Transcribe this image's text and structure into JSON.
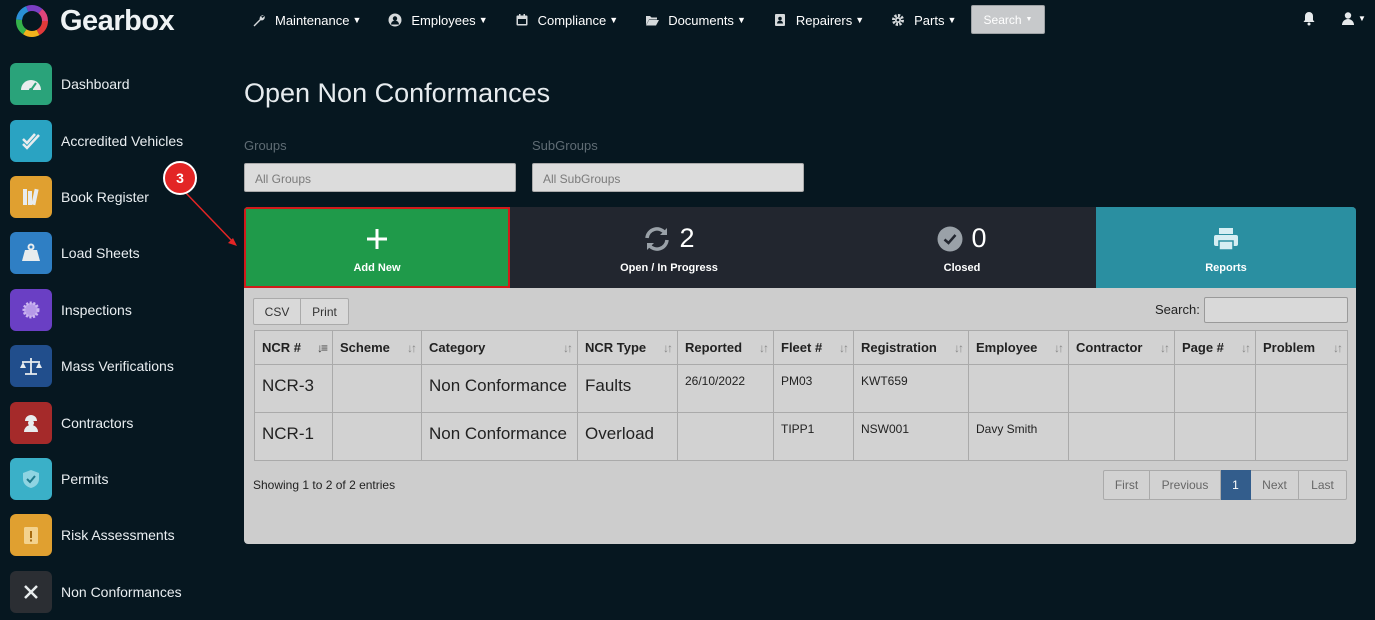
{
  "app": {
    "name": "Gearbox"
  },
  "colors": {
    "accent_green": "#1f9a4a",
    "reports_teal": "#2a8fa1",
    "callout_red": "#e32525",
    "page_active": "#335d8c"
  },
  "nav": {
    "menu": [
      {
        "label": "Maintenance",
        "icon": "wrench-icon"
      },
      {
        "label": "Employees",
        "icon": "person-circle-icon"
      },
      {
        "label": "Compliance",
        "icon": "calendar-icon"
      },
      {
        "label": "Documents",
        "icon": "folder-open-icon"
      },
      {
        "label": "Repairers",
        "icon": "address-book-icon"
      },
      {
        "label": "Parts",
        "icon": "gear-icon"
      }
    ],
    "search_label": "Search"
  },
  "sidebar": {
    "items": [
      {
        "label": "Dashboard",
        "icon": "speedometer-icon",
        "color": "#2aa37a"
      },
      {
        "label": "Accredited Vehicles",
        "icon": "check-double-icon",
        "color": "#2aa3c2"
      },
      {
        "label": "Book Register",
        "icon": "books-icon",
        "color": "#e0a030"
      },
      {
        "label": "Load Sheets",
        "icon": "weight-icon",
        "color": "#2f7fc4"
      },
      {
        "label": "Inspections",
        "icon": "badge-icon",
        "color": "#6a3fc4"
      },
      {
        "label": "Mass Verifications",
        "icon": "scales-icon",
        "color": "#214e8c"
      },
      {
        "label": "Contractors",
        "icon": "worker-icon",
        "color": "#a52a2a"
      },
      {
        "label": "Permits",
        "icon": "shield-check-icon",
        "color": "#3ab0c8"
      },
      {
        "label": "Risk Assessments",
        "icon": "clipboard-alert-icon",
        "color": "#e0a030"
      },
      {
        "label": "Non Conformances",
        "icon": "close-icon",
        "color": "#2b2e33"
      }
    ]
  },
  "page": {
    "title": "Open Non Conformances",
    "groups_label": "Groups",
    "groups_value": "All Groups",
    "subgroups_label": "SubGroups",
    "subgroups_value": "All SubGroups"
  },
  "stats": {
    "add_label": "Add New",
    "open_count": "2",
    "open_label": "Open / In Progress",
    "closed_count": "0",
    "closed_label": "Closed",
    "reports_label": "Reports"
  },
  "table": {
    "csv_label": "CSV",
    "print_label": "Print",
    "search_label": "Search:",
    "columns": [
      "NCR #",
      "Scheme",
      "Category",
      "NCR Type",
      "Reported",
      "Fleet #",
      "Registration",
      "Employee",
      "Contractor",
      "Page #",
      "Problem"
    ],
    "rows": [
      [
        "NCR-3",
        "",
        "Non Conformance",
        "Faults",
        "26/10/2022",
        "PM03",
        "KWT659",
        "",
        "",
        "",
        ""
      ],
      [
        "NCR-1",
        "",
        "Non Conformance",
        "Overload",
        "",
        "TIPP1",
        "NSW001",
        "Davy Smith",
        "",
        "",
        ""
      ]
    ],
    "info": "Showing 1 to 2 of 2 entries",
    "pager": [
      "First",
      "Previous",
      "1",
      "Next",
      "Last"
    ]
  },
  "callout": {
    "number": "3"
  }
}
